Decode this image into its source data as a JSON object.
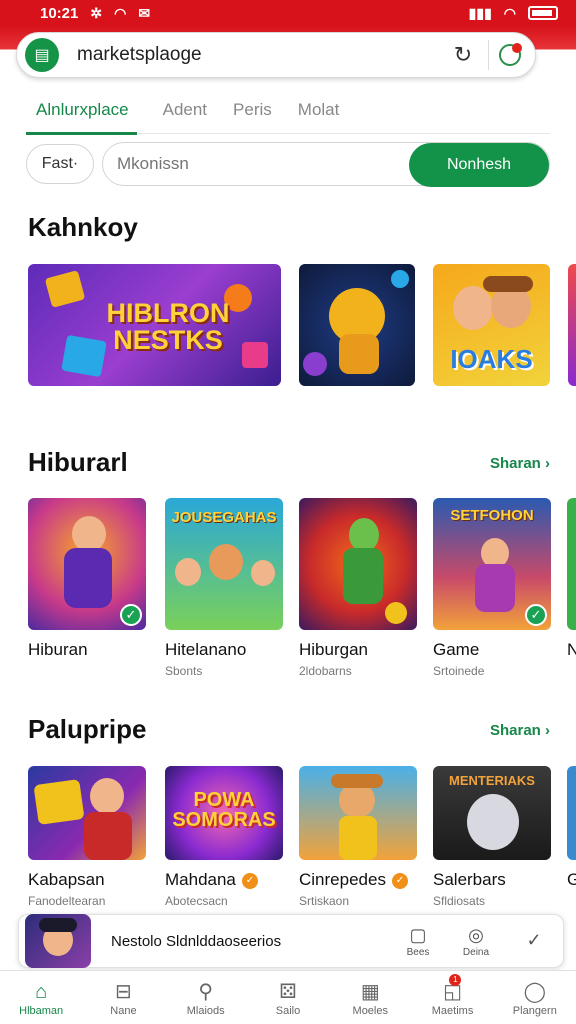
{
  "status_bar": {
    "time": "10:21"
  },
  "address_bar": {
    "url": "marketsplaoge"
  },
  "tabs": [
    {
      "label": "Alnlurxplace",
      "active": true
    },
    {
      "label": "Adent",
      "active": false
    },
    {
      "label": "Peris",
      "active": false
    },
    {
      "label": "Molat",
      "active": false
    }
  ],
  "filter": {
    "label": "Fast·"
  },
  "search": {
    "placeholder": "Mkonissn",
    "button_label": "Nonhesh"
  },
  "sections": {
    "featured": {
      "title": "Kahnkoy",
      "banners": [
        {
          "text": "HIBLRON NESTKS"
        },
        {
          "text": ""
        },
        {
          "text": "IOAKS"
        },
        {
          "text": ""
        }
      ]
    },
    "entertainment": {
      "title": "Hiburarl",
      "see_all": "Sharan ›",
      "items": [
        {
          "title": "Hiburan",
          "subtitle": "",
          "image_text": "",
          "badge": "check"
        },
        {
          "title": "Hitelanano",
          "subtitle": "Sbonts",
          "image_text": "JOUSEGAHAS",
          "badge": ""
        },
        {
          "title": "Hiburgan",
          "subtitle": "2ldobarns",
          "image_text": "",
          "badge": ""
        },
        {
          "title": "Game",
          "subtitle": "Srtoinede",
          "image_text": "SETFOHON",
          "badge": "check"
        },
        {
          "title": "N",
          "subtitle": "",
          "image_text": "",
          "badge": ""
        }
      ]
    },
    "popular": {
      "title": "Palupripe",
      "see_all": "Sharan ›",
      "items": [
        {
          "title": "Kabapsan",
          "subtitle": "Fanodeltearan",
          "image_text": ""
        },
        {
          "title": "Mahdana",
          "subtitle": "Abotecsacn",
          "image_text": "POWA SOMORAS"
        },
        {
          "title": "Cinrepedes",
          "subtitle": "Srtiskaon",
          "image_text": ""
        },
        {
          "title": "Salerbars",
          "subtitle": "Sfldiosats",
          "image_text": "MENTERIAKS"
        },
        {
          "title": "G",
          "subtitle": "",
          "image_text": ""
        }
      ]
    }
  },
  "mini_player": {
    "title": "Nestolo Sldnlddaoseerios",
    "actions": [
      {
        "icon": "clipboard-icon",
        "label": "Bees"
      },
      {
        "icon": "gamepad-icon",
        "label": "Deina"
      },
      {
        "icon": "check-circle-icon",
        "label": ""
      }
    ]
  },
  "bottom_nav": [
    {
      "label": "Hlbaman",
      "icon": "home-icon",
      "active": true
    },
    {
      "label": "Nane",
      "icon": "basket-icon",
      "active": false
    },
    {
      "label": "Mlaiods",
      "icon": "search-icon",
      "active": false
    },
    {
      "label": "Sailo",
      "icon": "dice-icon",
      "active": false
    },
    {
      "label": "Moeles",
      "icon": "grid-icon",
      "active": false
    },
    {
      "label": "Maetims",
      "icon": "message-icon",
      "active": false,
      "badge": "1"
    },
    {
      "label": "Plangern",
      "icon": "profile-icon",
      "active": false
    }
  ],
  "colors": {
    "brand_red": "#d8121a",
    "accent_green": "#17874a"
  }
}
